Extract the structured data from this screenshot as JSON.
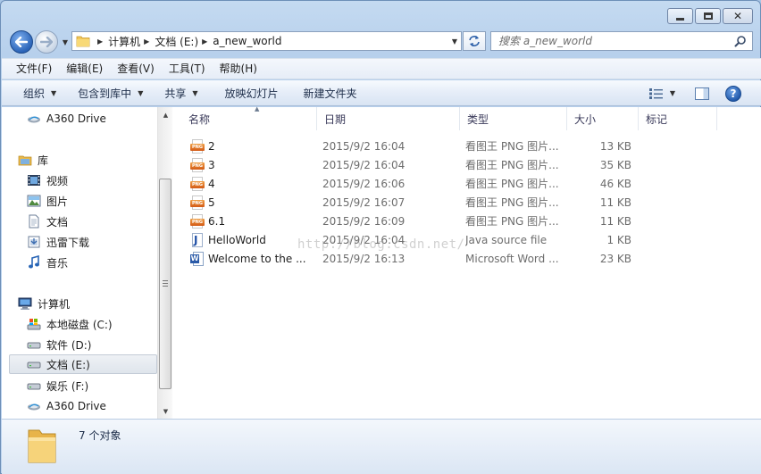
{
  "window": {
    "caption_buttons": [
      "minimize-icon",
      "maximize-icon",
      "close-icon"
    ],
    "close_glyph": "✕"
  },
  "address": {
    "crumbs": [
      "计算机",
      "文档 (E:)",
      "a_new_world"
    ]
  },
  "search": {
    "placeholder": "搜索 a_new_world"
  },
  "menubar": {
    "items": [
      "文件(F)",
      "编辑(E)",
      "查看(V)",
      "工具(T)",
      "帮助(H)"
    ]
  },
  "cmdbar": {
    "organize": "组织",
    "include_in_library": "包含到库中",
    "share": "共享",
    "slideshow": "放映幻灯片",
    "new_folder": "新建文件夹"
  },
  "navpane": {
    "items": [
      {
        "label": "A360 Drive",
        "icon": "cloud-drive-icon"
      },
      {
        "label": "库",
        "icon": "library-icon"
      },
      {
        "label": "视频",
        "icon": "video-library-icon"
      },
      {
        "label": "图片",
        "icon": "pictures-library-icon"
      },
      {
        "label": "文档",
        "icon": "documents-library-icon"
      },
      {
        "label": "迅雷下载",
        "icon": "downloads-library-icon"
      },
      {
        "label": "音乐",
        "icon": "music-library-icon"
      },
      {
        "label": "计算机",
        "icon": "computer-icon"
      },
      {
        "label": "本地磁盘 (C:)",
        "icon": "system-drive-icon"
      },
      {
        "label": "软件 (D:)",
        "icon": "drive-icon"
      },
      {
        "label": "文档 (E:)",
        "icon": "drive-icon",
        "selected": true
      },
      {
        "label": "娱乐 (F:)",
        "icon": "drive-icon"
      },
      {
        "label": "A360 Drive",
        "icon": "cloud-drive-icon"
      }
    ]
  },
  "columns": {
    "name": "名称",
    "date": "日期",
    "type": "类型",
    "size": "大小",
    "tags": "标记"
  },
  "files": [
    {
      "name": "2",
      "date": "2015/9/2 16:04",
      "type": "看图王 PNG 图片...",
      "size": "13 KB",
      "icon": "png-file-icon",
      "icon_text": "PNG"
    },
    {
      "name": "3",
      "date": "2015/9/2 16:04",
      "type": "看图王 PNG 图片...",
      "size": "35 KB",
      "icon": "png-file-icon",
      "icon_text": "PNG"
    },
    {
      "name": "4",
      "date": "2015/9/2 16:06",
      "type": "看图王 PNG 图片...",
      "size": "46 KB",
      "icon": "png-file-icon",
      "icon_text": "PNG"
    },
    {
      "name": "5",
      "date": "2015/9/2 16:07",
      "type": "看图王 PNG 图片...",
      "size": "11 KB",
      "icon": "png-file-icon",
      "icon_text": "PNG"
    },
    {
      "name": "6.1",
      "date": "2015/9/2 16:09",
      "type": "看图王 PNG 图片...",
      "size": "11 KB",
      "icon": "png-file-icon",
      "icon_text": "PNG"
    },
    {
      "name": "HelloWorld",
      "date": "2015/9/2 16:04",
      "type": "Java source file",
      "size": "1 KB",
      "icon": "java-file-icon",
      "icon_text": "J"
    },
    {
      "name": "Welcome to  the ...",
      "date": "2015/9/2 16:13",
      "type": "Microsoft Word ...",
      "size": "23 KB",
      "icon": "word-file-icon",
      "icon_text": "W"
    }
  ],
  "watermark": "http://blog.csdn.net/",
  "details": {
    "count_text": "7 个对象"
  },
  "colors": {
    "accent": "#2b64b8",
    "png_badge": "#e07a2a",
    "selection_bg": "#e4e9ef"
  }
}
